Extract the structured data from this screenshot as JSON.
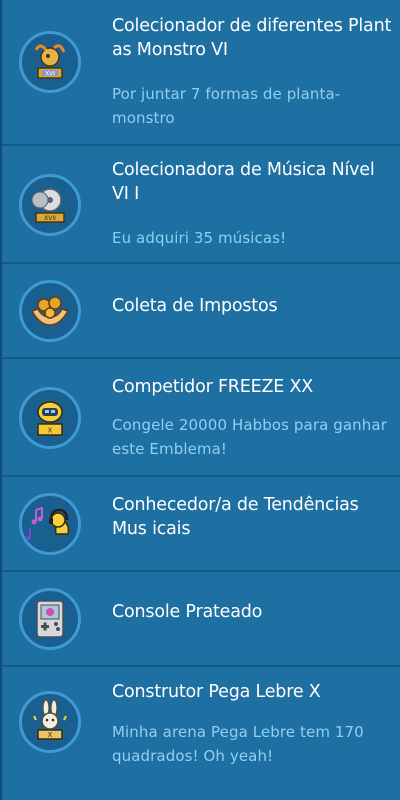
{
  "badges": [
    {
      "title": "Colecionador de diferentes Plant as Monstro VI",
      "description": "Por juntar 7 formas de planta-monstro",
      "icon": "plant-monster-trophy-icon"
    },
    {
      "title": "Colecionadora de Música Nível VI I",
      "description": "Eu adquiri 35 músicas!",
      "icon": "music-cd-trophy-icon"
    },
    {
      "title": "Coleta de Impostos",
      "description": "",
      "icon": "coins-in-hands-icon"
    },
    {
      "title": "Competidor FREEZE XX",
      "description": "Congele 20000 Habbos para ganhar este Emblema!",
      "icon": "freeze-trophy-icon"
    },
    {
      "title": "Conhecedor/a de Tendências Mus icais",
      "description": "",
      "icon": "music-duck-headphones-icon"
    },
    {
      "title": "Console Prateado",
      "description": "",
      "icon": "silver-console-icon"
    },
    {
      "title": "Construtor Pega Lebre X",
      "description": "Minha arena Pega Lebre tem 170 quadrados! Oh yeah!",
      "icon": "bunny-trophy-icon"
    }
  ],
  "colors": {
    "background": "#1e6fa2",
    "divider": "#0f5b8a",
    "title": "#ffffff",
    "description": "#8fd0f2",
    "badge_ring": "#3f9ad3"
  }
}
